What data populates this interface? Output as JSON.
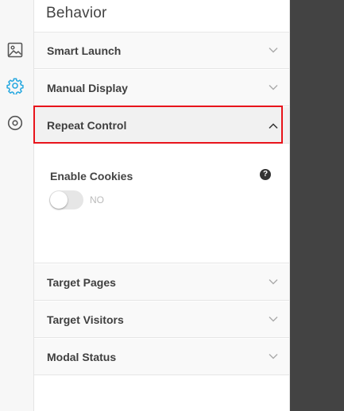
{
  "sidebar_icons": [
    {
      "name": "image-icon",
      "active": false
    },
    {
      "name": "gear-icon",
      "active": true
    },
    {
      "name": "target-icon",
      "active": false
    }
  ],
  "panel": {
    "title": "Behavior",
    "sections_before": [
      {
        "label": "Smart Launch",
        "expanded": false
      },
      {
        "label": "Manual Display",
        "expanded": false
      }
    ],
    "active_section": {
      "label": "Repeat Control",
      "expanded": true,
      "field": {
        "label": "Enable Cookies",
        "help_glyph": "?",
        "toggle_state": "NO"
      }
    },
    "sections_after": [
      {
        "label": "Target Pages",
        "expanded": false
      },
      {
        "label": "Target Visitors",
        "expanded": false
      },
      {
        "label": "Modal Status",
        "expanded": false
      }
    ]
  },
  "colors": {
    "accent": "#29a9e0",
    "highlight_border": "#e8141b",
    "dark_area": "#434343"
  }
}
